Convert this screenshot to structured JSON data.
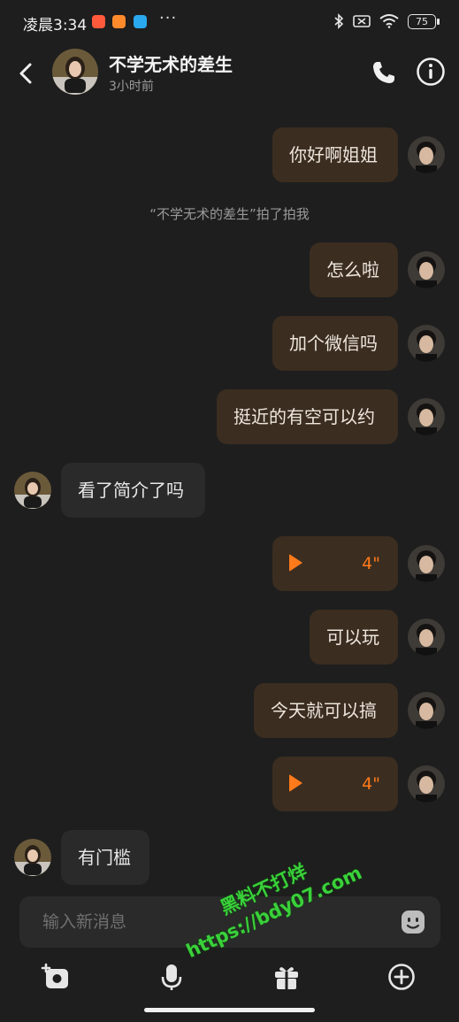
{
  "status_bar": {
    "time": "凌晨3:34",
    "more": "···",
    "battery": "75"
  },
  "header": {
    "name": "不学无术的差生",
    "subtitle": "3小时前"
  },
  "messages": [
    {
      "side": "right",
      "type": "text",
      "text": "你好啊姐姐"
    },
    {
      "side": "center",
      "type": "system",
      "text": "“不学无术的差生”拍了拍我"
    },
    {
      "side": "right",
      "type": "text",
      "text": "怎么啦"
    },
    {
      "side": "right",
      "type": "text",
      "text": "加个微信吗"
    },
    {
      "side": "right",
      "type": "text",
      "text": "挺近的有空可以约"
    },
    {
      "side": "left",
      "type": "text",
      "text": "看了简介了吗"
    },
    {
      "side": "right",
      "type": "voice",
      "duration": "4\""
    },
    {
      "side": "right",
      "type": "text",
      "text": "可以玩"
    },
    {
      "side": "right",
      "type": "text",
      "text": "今天就可以搞"
    },
    {
      "side": "right",
      "type": "voice",
      "duration": "4\""
    },
    {
      "side": "left",
      "type": "text",
      "text": "有门槛"
    }
  ],
  "input": {
    "placeholder": "输入新消息",
    "value": ""
  },
  "watermark": {
    "line1": "黑料不打烊",
    "line2": "https://bdy07.com"
  },
  "colors": {
    "background": "#1e1e1e",
    "bubble_sent": "#3b2d20",
    "bubble_received": "#2a2a2a",
    "voice_accent": "#ff7a1a"
  },
  "icons": [
    "back-icon",
    "phone-icon",
    "info-icon",
    "play-icon",
    "emoji-icon",
    "camera-icon",
    "mic-icon",
    "gift-icon",
    "add-icon"
  ]
}
